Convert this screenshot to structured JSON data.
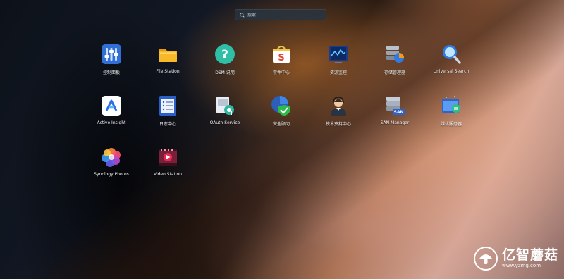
{
  "search": {
    "placeholder": "搜索"
  },
  "apps": [
    {
      "label": "控制面板",
      "icon": "control-panel-icon"
    },
    {
      "label": "File Station",
      "icon": "folder-icon"
    },
    {
      "label": "DSM 说明",
      "icon": "help-icon"
    },
    {
      "label": "套件中心",
      "icon": "package-center-icon"
    },
    {
      "label": "资源监控",
      "icon": "resource-monitor-icon"
    },
    {
      "label": "存储管理器",
      "icon": "storage-manager-icon"
    },
    {
      "label": "Universal Search",
      "icon": "universal-search-icon"
    },
    {
      "label": "Active Insight",
      "icon": "active-insight-icon"
    },
    {
      "label": "日志中心",
      "icon": "log-center-icon"
    },
    {
      "label": "OAuth Service",
      "icon": "oauth-service-icon"
    },
    {
      "label": "安全顾问",
      "icon": "security-advisor-icon"
    },
    {
      "label": "技术支持中心",
      "icon": "support-center-icon"
    },
    {
      "label": "SAN Manager",
      "icon": "san-manager-icon"
    },
    {
      "label": "媒体服务器",
      "icon": "media-server-icon"
    },
    {
      "label": "Synology Photos",
      "icon": "synology-photos-icon"
    },
    {
      "label": "Video Station",
      "icon": "video-station-icon"
    }
  ],
  "watermark": {
    "title": "亿智蘑菇",
    "url": "www.yzmg.com"
  }
}
